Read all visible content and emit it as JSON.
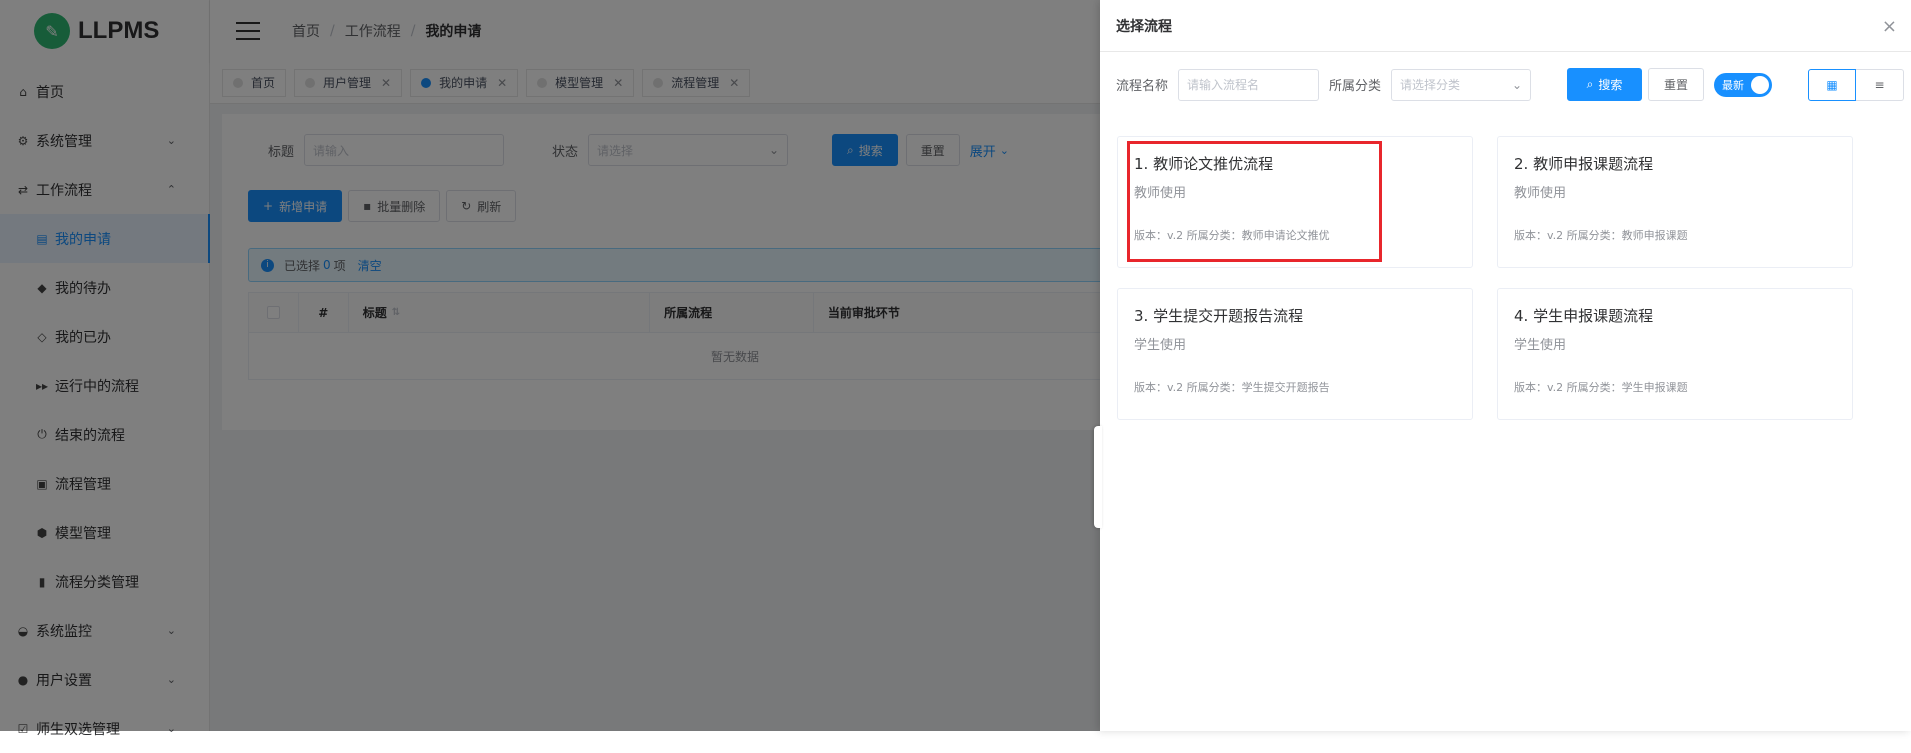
{
  "app": {
    "logo_text": "LLPMS"
  },
  "sidebar": {
    "items": [
      {
        "label": "首页",
        "icon": "home-icon"
      },
      {
        "label": "系统管理",
        "icon": "gear-icon",
        "chevron": "down"
      },
      {
        "label": "工作流程",
        "icon": "workflow-icon",
        "chevron": "up"
      },
      {
        "label": "我的申请",
        "icon": "clipboard-icon",
        "active": true
      },
      {
        "label": "我的待办",
        "icon": "tag-icon"
      },
      {
        "label": "我的已办",
        "icon": "tag-outline-icon"
      },
      {
        "label": "运行中的流程",
        "icon": "fast-forward-icon"
      },
      {
        "label": "结束的流程",
        "icon": "power-icon"
      },
      {
        "label": "流程管理",
        "icon": "calendar-icon"
      },
      {
        "label": "模型管理",
        "icon": "cube-icon"
      },
      {
        "label": "流程分类管理",
        "icon": "bookmark-icon"
      },
      {
        "label": "系统监控",
        "icon": "monitor-icon",
        "chevron": "down"
      },
      {
        "label": "用户设置",
        "icon": "user-icon",
        "chevron": "down"
      },
      {
        "label": "师生双选管理",
        "icon": "check-icon",
        "chevron": "down"
      }
    ]
  },
  "header": {
    "breadcrumbs": [
      "首页",
      "工作流程",
      "我的申请"
    ],
    "sep": "/"
  },
  "tags": [
    {
      "label": "首页",
      "closable": false,
      "active": false
    },
    {
      "label": "用户管理",
      "closable": true,
      "active": false
    },
    {
      "label": "我的申请",
      "closable": true,
      "active": true
    },
    {
      "label": "模型管理",
      "closable": true,
      "active": false
    },
    {
      "label": "流程管理",
      "closable": true,
      "active": false
    }
  ],
  "main": {
    "filter": {
      "title_label": "标题",
      "title_placeholder": "请输入",
      "status_label": "状态",
      "status_placeholder": "请选择",
      "search_btn": "搜索",
      "reset_btn": "重置",
      "expand_btn": "展开"
    },
    "toolbar": {
      "add_btn": "新增申请",
      "batch_delete_btn": "批量删除",
      "refresh_btn": "刷新"
    },
    "alert": {
      "prefix": "已选择",
      "count": "0",
      "suffix": "项",
      "clear": "清空"
    },
    "table": {
      "columns": [
        "#",
        "标题",
        "所属流程",
        "当前审批环节"
      ],
      "empty_text": "暂无数据"
    }
  },
  "drawer": {
    "title": "选择流程",
    "close": "×",
    "search": {
      "name_label": "流程名称",
      "name_placeholder": "请输入流程名",
      "category_label": "所属分类",
      "category_placeholder": "请选择分类",
      "search_btn": "搜索",
      "reset_btn": "重置",
      "latest_toggle": "最新"
    },
    "processes": [
      {
        "title": "1. 教师论文推优流程",
        "desc": "教师使用",
        "meta": "版本：v.2 所属分类：教师申请论文推优"
      },
      {
        "title": "2. 教师申报课题流程",
        "desc": "教师使用",
        "meta": "版本：v.2 所属分类：教师申报课题"
      },
      {
        "title": "3. 学生提交开题报告流程",
        "desc": "学生使用",
        "meta": "版本：v.2 所属分类：学生提交开题报告"
      },
      {
        "title": "4. 学生申报课题流程",
        "desc": "学生使用",
        "meta": "版本：v.2 所属分类：学生申报课题"
      }
    ]
  },
  "colors": {
    "primary": "#1890ff",
    "highlight": "#e8262c",
    "logo": "#2eb872"
  }
}
